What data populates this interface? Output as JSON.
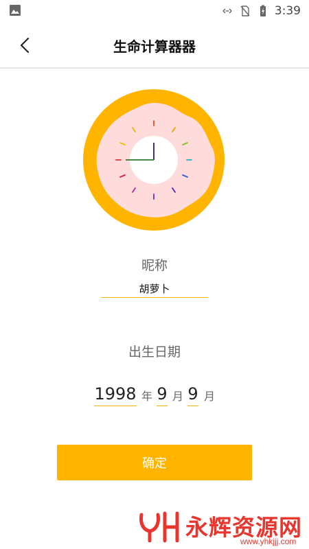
{
  "status_bar": {
    "time": "3:39",
    "icons": [
      "image-icon",
      "data-arrows-icon",
      "no-sim-icon",
      "battery-charging-icon"
    ]
  },
  "header": {
    "title": "生命计算器器",
    "back_icon": "chevron-left-icon"
  },
  "illustration": {
    "name": "donut-clock",
    "colors": {
      "outer": "#ffb400",
      "frosting": "#ffdcdc",
      "center": "#ffffff",
      "hour_hand": "#2a7a2a",
      "minute_hand": "#2a1a6a"
    }
  },
  "form": {
    "nickname_label": "昵称",
    "nickname_value": "胡萝卜",
    "birth_label": "出生日期",
    "year_value": "1998",
    "year_unit": "年",
    "month_value": "9",
    "month_unit": "月",
    "day_value": "9",
    "day_unit": "月"
  },
  "actions": {
    "confirm_label": "确定"
  },
  "watermark": {
    "name": "永辉资源网",
    "url": "www.yhkjjj.com"
  },
  "colors": {
    "accent": "#ffb400",
    "underline": "#f2b300",
    "watermark": "#e8362e"
  }
}
